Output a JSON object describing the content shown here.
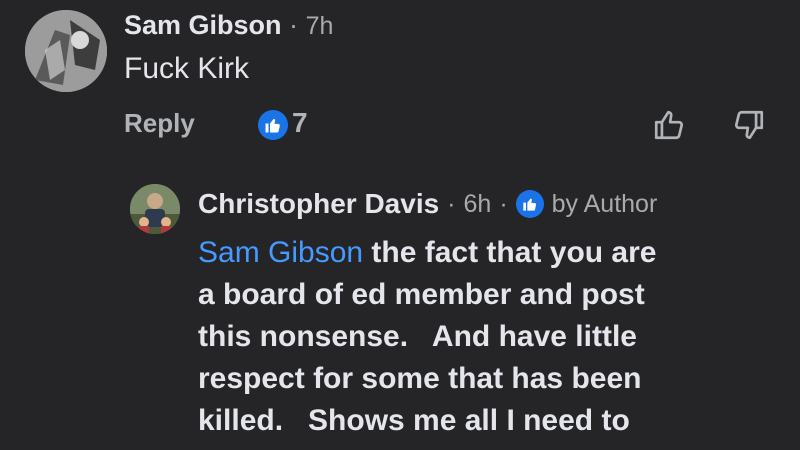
{
  "top_comment": {
    "author": "Sam Gibson",
    "separator": "·",
    "time": "7h",
    "text": "Fuck Kirk",
    "reply_label": "Reply",
    "reaction_count": "7",
    "reaction_icon": "thumbs-up-icon",
    "actions": [
      "thumb-up-icon",
      "thumb-down-icon"
    ]
  },
  "reply_comment": {
    "author": "Christopher Davis",
    "separator1": "·",
    "time": "6h",
    "separator2": "·",
    "badge_icon": "thumbs-up-icon",
    "badge_label": "by Author",
    "mention": "Sam Gibson",
    "line1_rest": " the fact that you are",
    "line2": "a board of ed member and post",
    "line3": "this nonsense.   And have little",
    "line4": "respect for some that has been",
    "line5": "killed.   Shows me all I need to"
  },
  "colors": {
    "background": "#252527",
    "text_primary": "#e4e6eb",
    "text_secondary": "#b0b3b8",
    "link": "#4599ff",
    "reaction_blue": "#1a74e8"
  }
}
